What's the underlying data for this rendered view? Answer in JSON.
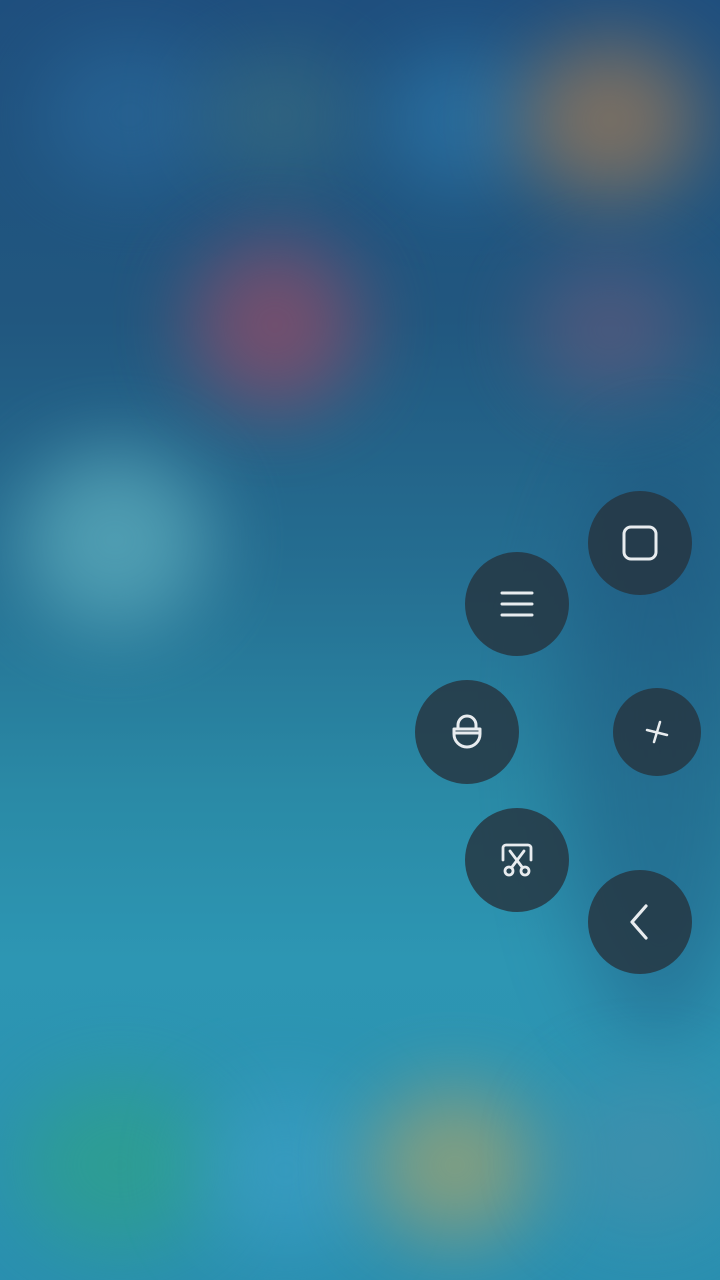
{
  "quick_ball": {
    "buttons": [
      {
        "id": "home",
        "icon": "square-icon"
      },
      {
        "id": "menu",
        "icon": "hamburger-menu-icon"
      },
      {
        "id": "lock",
        "icon": "lock-icon"
      },
      {
        "id": "close",
        "icon": "close-x-icon"
      },
      {
        "id": "screenshot",
        "icon": "scissors-screenshot-icon"
      },
      {
        "id": "back",
        "icon": "chevron-left-icon"
      }
    ]
  },
  "colors": {
    "button_bg": "#263440",
    "icon_stroke": "#e8ecef"
  }
}
